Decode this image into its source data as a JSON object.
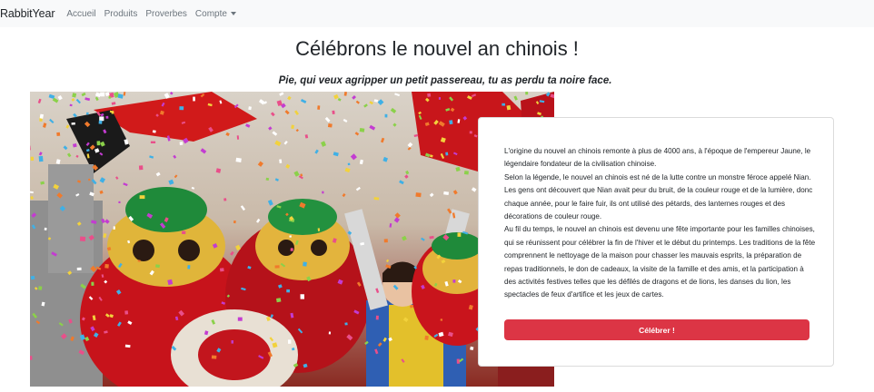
{
  "navbar": {
    "brand": "RabbitYear",
    "links": [
      "Accueil",
      "Produits",
      "Proverbes"
    ],
    "account_label": "Compte"
  },
  "page": {
    "title": "Célébrons le nouvel an chinois !",
    "proverb": "Pie, qui veux agripper un petit passereau, tu as perdu ta noire face."
  },
  "card": {
    "paragraphs": [
      "L'origine du nouvel an chinois remonte à plus de 4000 ans, à l'époque de l'empereur Jaune, le légendaire fondateur de la civilisation chinoise.",
      "Selon la légende, le nouvel an chinois est né de la lutte contre un monstre féroce appelé Nian. Les gens ont découvert que Nian avait peur du bruit, de la couleur rouge et de la lumière, donc chaque année, pour le faire fuir, ils ont utilisé des pétards, des lanternes rouges et des décorations de couleur rouge.",
      "Au fil du temps, le nouvel an chinois est devenu une fête importante pour les familles chinoises, qui se réunissent pour célébrer la fin de l'hiver et le début du printemps. Les traditions de la fête comprennent le nettoyage de la maison pour chasser les mauvais esprits, la préparation de repas traditionnels, le don de cadeaux, la visite de la famille et des amis, et la participation à des activités festives telles que les défilés de dragons et de lions, les danses du lion, les spectacles de feux d'artifice et les jeux de cartes."
    ],
    "button_label": "Célébrer !"
  },
  "colors": {
    "navbar_bg": "#f8f9fa",
    "button": "#dc3545"
  },
  "icons": {
    "account_dropdown": "caret-down-icon"
  }
}
